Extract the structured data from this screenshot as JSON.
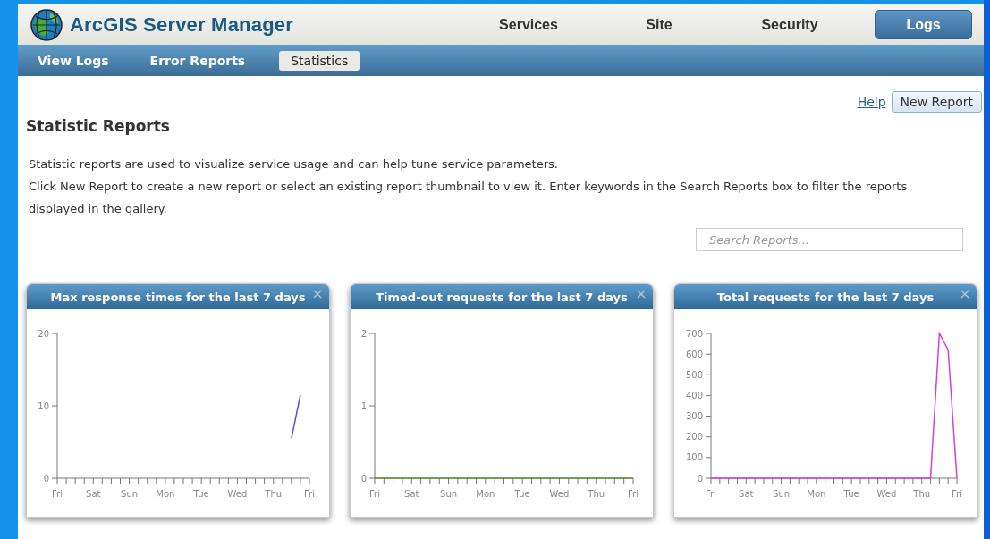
{
  "header": {
    "title": "ArcGIS Server Manager",
    "nav": [
      {
        "label": "Services",
        "selected": false
      },
      {
        "label": "Site",
        "selected": false
      },
      {
        "label": "Security",
        "selected": false
      },
      {
        "label": "Logs",
        "selected": true
      }
    ]
  },
  "subnav": [
    {
      "label": "View Logs",
      "selected": false
    },
    {
      "label": "Error Reports",
      "selected": false
    },
    {
      "label": "Statistics",
      "selected": true
    }
  ],
  "toolbar": {
    "help_link": "Help",
    "new_report_button": "New Report"
  },
  "page_title": "Statistic Reports",
  "paragraphs": [
    "Statistic reports are used to visualize service usage and can help tune service parameters.",
    "Click New Report to create a new report or select an existing report thumbnail to view it. Enter keywords in the Search Reports box to filter the reports displayed in the gallery."
  ],
  "search": {
    "placeholder": "Search Reports..."
  },
  "reports": [
    {
      "title": "Max response times for the last 7 days",
      "chart_data": {
        "type": "line",
        "categories": [
          "Fri",
          null,
          null,
          null,
          "Sat",
          null,
          null,
          null,
          "Sun",
          null,
          null,
          null,
          "Mon",
          null,
          null,
          null,
          "Tue",
          null,
          null,
          null,
          "Wed",
          null,
          null,
          null,
          "Thu",
          null,
          null,
          null,
          "Fri"
        ],
        "ylim": [
          0,
          20
        ],
        "yticks": [
          0,
          10,
          20
        ],
        "series": [
          {
            "color": "#5b4fd6",
            "values": [
              null,
              null,
              null,
              null,
              null,
              null,
              null,
              null,
              null,
              null,
              null,
              null,
              null,
              null,
              null,
              null,
              null,
              null,
              null,
              null,
              null,
              null,
              null,
              null,
              null,
              null,
              5.5,
              11.5,
              null
            ]
          }
        ]
      }
    },
    {
      "title": "Timed-out requests for the last 7 days",
      "chart_data": {
        "type": "line",
        "categories": [
          "Fri",
          null,
          null,
          null,
          "Sat",
          null,
          null,
          null,
          "Sun",
          null,
          null,
          null,
          "Mon",
          null,
          null,
          null,
          "Tue",
          null,
          null,
          null,
          "Wed",
          null,
          null,
          null,
          "Thu",
          null,
          null,
          null,
          "Fri"
        ],
        "ylim": [
          0,
          2
        ],
        "yticks": [
          0,
          1,
          2
        ],
        "series": [
          {
            "color": "#5a9a2e",
            "values": [
              0,
              0,
              0,
              0,
              0,
              0,
              0,
              0,
              0,
              0,
              0,
              0,
              0,
              0,
              0,
              0,
              0,
              0,
              0,
              0,
              0,
              0,
              0,
              0,
              0,
              0,
              0,
              0,
              0
            ]
          }
        ]
      }
    },
    {
      "title": "Total requests for the last 7 days",
      "chart_data": {
        "type": "line",
        "categories": [
          "Fri",
          null,
          null,
          null,
          "Sat",
          null,
          null,
          null,
          "Sun",
          null,
          null,
          null,
          "Mon",
          null,
          null,
          null,
          "Tue",
          null,
          null,
          null,
          "Wed",
          null,
          null,
          null,
          "Thu",
          null,
          null,
          null,
          "Fri"
        ],
        "ylim": [
          0,
          700
        ],
        "yticks": [
          0,
          100,
          200,
          300,
          400,
          500,
          600,
          700
        ],
        "series": [
          {
            "color": "#d83fd8",
            "values": [
              0,
              0,
              0,
              0,
              0,
              0,
              0,
              0,
              0,
              0,
              0,
              0,
              0,
              0,
              0,
              0,
              0,
              0,
              0,
              0,
              0,
              0,
              0,
              0,
              0,
              0,
              700,
              620,
              0
            ]
          }
        ]
      }
    }
  ]
}
